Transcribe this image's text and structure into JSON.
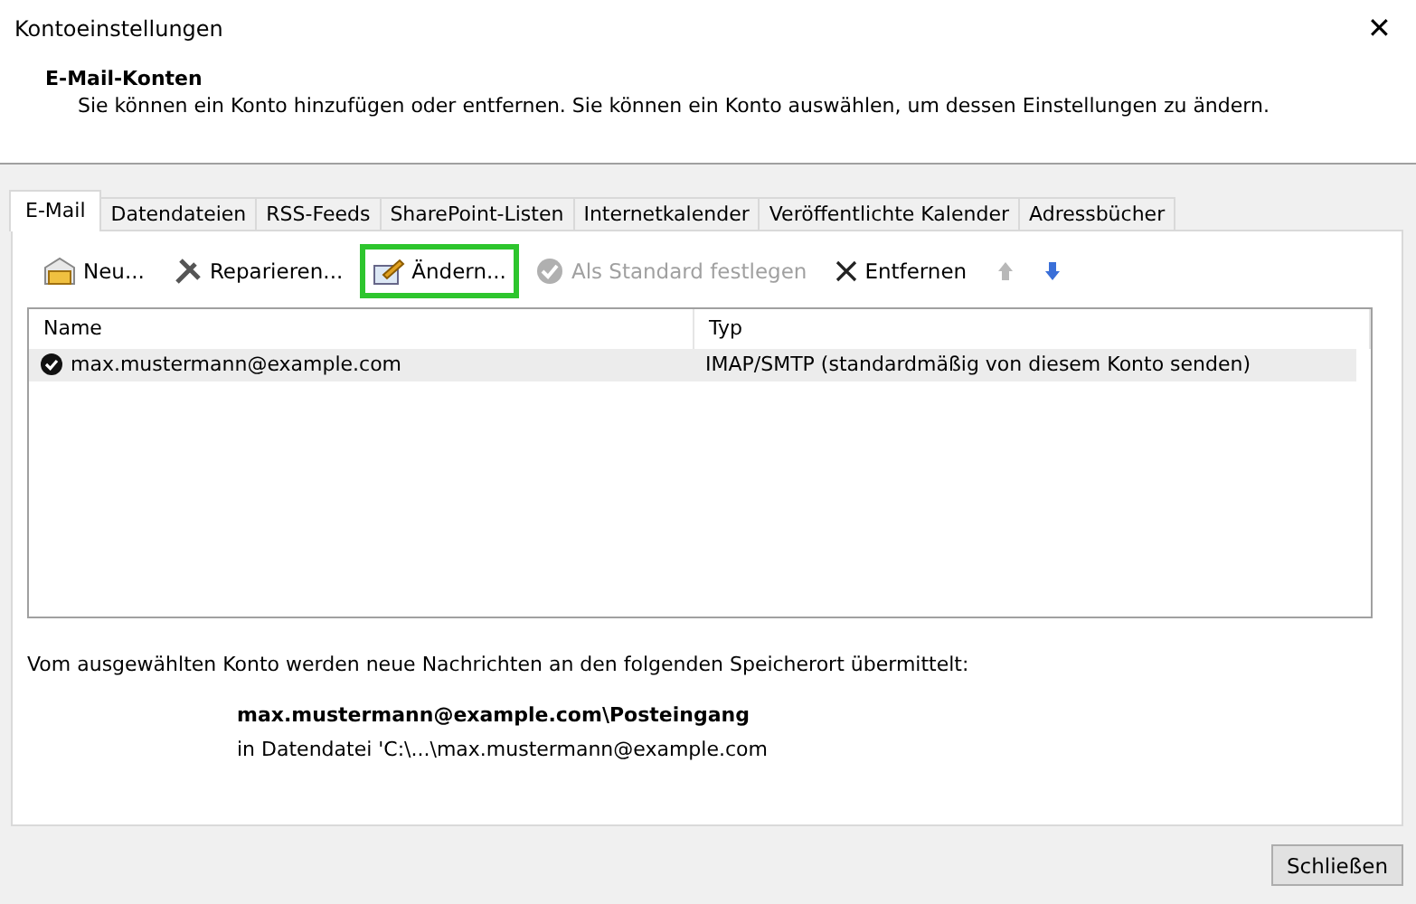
{
  "window": {
    "title": "Kontoeinstellungen",
    "close": "✕"
  },
  "header": {
    "title": "E-Mail-Konten",
    "description": "Sie können ein Konto hinzufügen oder entfernen. Sie können ein Konto auswählen, um dessen Einstellungen zu ändern."
  },
  "tabs": [
    {
      "label": "E-Mail",
      "selected": true
    },
    {
      "label": "Datendateien",
      "selected": false
    },
    {
      "label": "RSS-Feeds",
      "selected": false
    },
    {
      "label": "SharePoint-Listen",
      "selected": false
    },
    {
      "label": "Internetkalender",
      "selected": false
    },
    {
      "label": "Veröffentlichte Kalender",
      "selected": false
    },
    {
      "label": "Adressbücher",
      "selected": false
    }
  ],
  "toolbar": [
    {
      "kind": "new",
      "label": "Neu...",
      "disabled": false,
      "highlighted": false
    },
    {
      "kind": "repair",
      "label": "Reparieren...",
      "disabled": false,
      "highlighted": false
    },
    {
      "kind": "change",
      "label": "Ändern...",
      "disabled": false,
      "highlighted": true
    },
    {
      "kind": "default",
      "label": "Als Standard festlegen",
      "disabled": true,
      "highlighted": false
    },
    {
      "kind": "remove",
      "label": "Entfernen",
      "disabled": false,
      "highlighted": false
    },
    {
      "kind": "up",
      "disabled": true,
      "highlighted": false
    },
    {
      "kind": "down",
      "disabled": false,
      "highlighted": false
    }
  ],
  "table": {
    "columns": [
      "Name",
      "Typ"
    ],
    "rows": [
      {
        "cells": [
          "max.mustermann@example.com",
          "IMAP/SMTP (standardmäßig von diesem Konto senden)"
        ],
        "selected": true,
        "default": true
      }
    ]
  },
  "delivery": {
    "intro": "Vom ausgewählten Konto werden neue Nachrichten an den folgenden Speicherort übermittelt:",
    "folder": "max.mustermann@example.com\\Posteingang",
    "file": "in Datendatei 'C:\\...\\max.mustermann@example.com"
  },
  "buttons": [
    "Schließen"
  ]
}
